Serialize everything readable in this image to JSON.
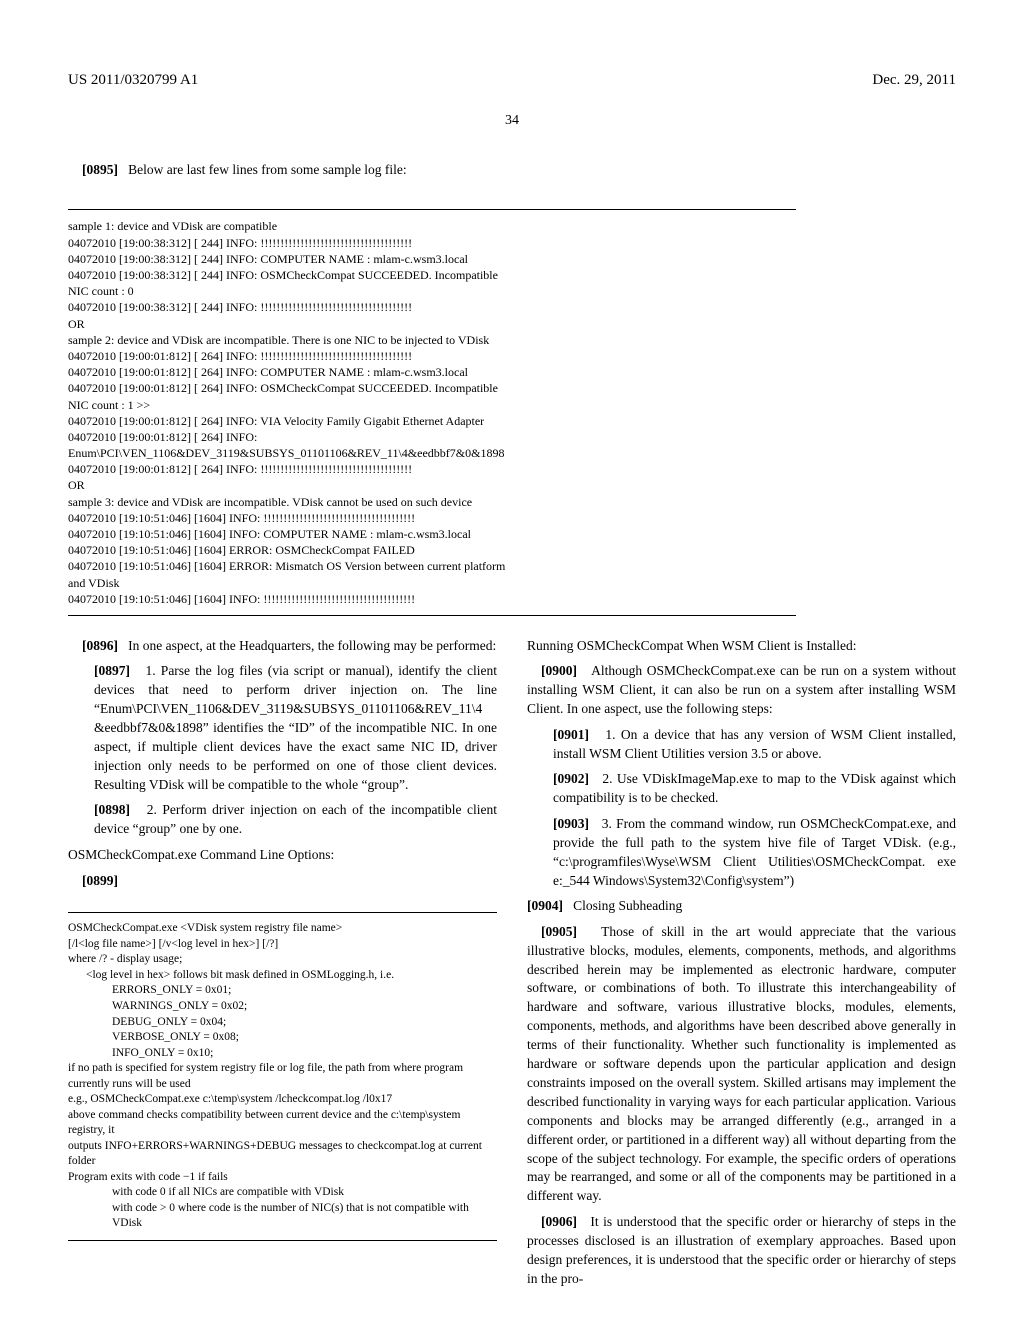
{
  "header": {
    "left": "US 2011/0320799 A1",
    "right": "Dec. 29, 2011"
  },
  "page_number": "34",
  "intro": {
    "num": "[0895]",
    "text": "Below are last few lines from some sample log file:"
  },
  "log_block": "sample 1: device and VDisk are compatible\n04072010 [19:00:38:312] [ 244] INFO: !!!!!!!!!!!!!!!!!!!!!!!!!!!!!!!!!!!!!!\n04072010 [19:00:38:312] [ 244] INFO: COMPUTER NAME : mlam-c.wsm3.local\n04072010 [19:00:38:312] [ 244] INFO: OSMCheckCompat SUCCEEDED. Incompatible\nNIC count : 0\n04072010 [19:00:38:312] [ 244] INFO: !!!!!!!!!!!!!!!!!!!!!!!!!!!!!!!!!!!!!!\nOR\nsample 2: device and VDisk are incompatible. There is one NIC to be injected to VDisk\n04072010 [19:00:01:812] [ 264] INFO: !!!!!!!!!!!!!!!!!!!!!!!!!!!!!!!!!!!!!!\n04072010 [19:00:01:812] [ 264] INFO: COMPUTER NAME : mlam-c.wsm3.local\n04072010 [19:00:01:812] [ 264] INFO: OSMCheckCompat SUCCEEDED. Incompatible\nNIC count : 1 >>\n04072010 [19:00:01:812] [ 264] INFO: VIA Velocity Family Gigabit Ethernet Adapter\n04072010 [19:00:01:812] [ 264] INFO:\nEnum\\PCI\\VEN_1106&DEV_3119&SUBSYS_01101106&REV_11\\4&eedbbf7&0&1898\n04072010 [19:00:01:812] [ 264] INFO: !!!!!!!!!!!!!!!!!!!!!!!!!!!!!!!!!!!!!!\nOR\nsample 3: device and VDisk are incompatible. VDisk cannot be used on such device\n04072010 [19:10:51:046] [1604] INFO: !!!!!!!!!!!!!!!!!!!!!!!!!!!!!!!!!!!!!!\n04072010 [19:10:51:046] [1604] INFO: COMPUTER NAME : mlam-c.wsm3.local\n04072010 [19:10:51:046] [1604] ERROR: OSMCheckCompat FAILED\n04072010 [19:10:51:046] [1604] ERROR: Mismatch OS Version between current platform\nand VDisk\n04072010 [19:10:51:046] [1604] INFO: !!!!!!!!!!!!!!!!!!!!!!!!!!!!!!!!!!!!!!",
  "left_col": {
    "p0896": {
      "num": "[0896]",
      "text": "In one aspect, at the Headquarters, the following may be performed:"
    },
    "p0897": {
      "num": "[0897]",
      "text": "1. Parse the log files (via script or manual), identify the client devices that need to perform driver injection on. The line “Enum\\PCI\\VEN_1106&DEV_3119&SUBSYS_01101106&REV_11\\4 &eedbbf7&0&1898” identifies the “ID” of the incompatible NIC. In one aspect, if multiple client devices have the exact same NIC ID, driver injection only needs to be performed on one of those client devices. Resulting VDisk will be compatible to the whole “group”."
    },
    "p0898": {
      "num": "[0898]",
      "text": "2. Perform driver injection on each of the incompatible client device “group” one by one."
    },
    "cmd_title": "OSMCheckCompat.exe Command Line Options:",
    "p0899_num": "[0899]",
    "cmd_lines": {
      "l1": "OSMCheckCompat.exe <VDisk system registry file name>",
      "l2": "[/l<log file name>] [/v<log level in hex>] [/?]",
      "l3": "where /? - display usage;",
      "l4": "<log level in hex> follows bit mask defined in OSMLogging.h, i.e.",
      "l5": "ERRORS_ONLY = 0x01;",
      "l6": "WARNINGS_ONLY = 0x02;",
      "l7": "DEBUG_ONLY = 0x04;",
      "l8": "VERBOSE_ONLY = 0x08;",
      "l9": "INFO_ONLY           = 0x10;",
      "l10": "if no path is specified for system registry file or log file, the path from where program currently runs will be used",
      "l11": "e.g., OSMCheckCompat.exe c:\\temp\\system /lcheckcompat.log /l0x17",
      "l12": "above command checks compatibility between current device and the c:\\temp\\system registry, it",
      "l13": "outputs INFO+ERRORS+WARNINGS+DEBUG messages to checkcompat.log at current folder",
      "l14": "Program exits with code −1 if fails",
      "l15": "with code 0 if all NICs are compatible with VDisk",
      "l16": "with code > 0 where code is the number of NIC(s) that is not compatible with VDisk"
    }
  },
  "right_col": {
    "run_title": "Running OSMCheckCompat When WSM Client is Installed:",
    "p0900": {
      "num": "[0900]",
      "text": "Although OSMCheckCompat.exe can be run on a system without installing WSM Client, it can also be run on a system after installing WSM Client. In one aspect, use the following steps:"
    },
    "p0901": {
      "num": "[0901]",
      "text": "1. On a device that has any version of WSM Client installed, install WSM Client Utilities version 3.5 or above."
    },
    "p0902": {
      "num": "[0902]",
      "text": "2. Use VDiskImageMap.exe to map to the VDisk against which compatibility is to be checked."
    },
    "p0903": {
      "num": "[0903]",
      "text": "3. From the command window, run OSMCheckCompat.exe, and provide the full path to the system hive file of Target VDisk. (e.g., “c:\\programfiles\\Wyse\\WSM Client Utilities\\OSMCheckCompat. exe e:_544 Windows\\System32\\Config\\system”)"
    },
    "p0904": {
      "num": "[0904]",
      "text": "Closing Subheading"
    },
    "p0905": {
      "num": "[0905]",
      "text": "Those of skill in the art would appreciate that the various illustrative blocks, modules, elements, components, methods, and algorithms described herein may be implemented as electronic hardware, computer software, or combinations of both. To illustrate this interchangeability of hardware and software, various illustrative blocks, modules, elements, components, methods, and algorithms have been described above generally in terms of their functionality. Whether such functionality is implemented as hardware or software depends upon the particular application and design constraints imposed on the overall system. Skilled artisans may implement the described functionality in varying ways for each particular application. Various components and blocks may be arranged differently (e.g., arranged in a different order, or partitioned in a different way) all without departing from the scope of the subject technology. For example, the specific orders of operations may be rearranged, and some or all of the components may be partitioned in a different way."
    },
    "p0906": {
      "num": "[0906]",
      "text": "It is understood that the specific order or hierarchy of steps in the processes disclosed is an illustration of exemplary approaches. Based upon design preferences, it is understood that the specific order or hierarchy of steps in the pro-"
    }
  }
}
